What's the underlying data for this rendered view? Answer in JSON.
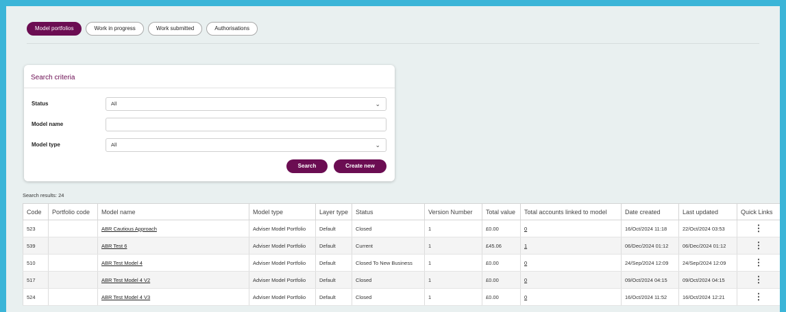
{
  "tabs": [
    {
      "label": "Model portfolios",
      "active": true
    },
    {
      "label": "Work in progress",
      "active": false
    },
    {
      "label": "Work submitted",
      "active": false
    },
    {
      "label": "Authorisations",
      "active": false
    }
  ],
  "search": {
    "title": "Search criteria",
    "status_label": "Status",
    "status_value": "All",
    "model_name_label": "Model name",
    "model_name_value": "",
    "model_type_label": "Model type",
    "model_type_value": "All",
    "search_button": "Search",
    "create_button": "Create new"
  },
  "results": {
    "summary": "Search results: 24",
    "columns": [
      "Code",
      "Portfolio code",
      "Model name",
      "Model type",
      "Layer type",
      "Status",
      "Version Number",
      "Total value",
      "Total accounts linked to model",
      "Date created",
      "Last updated",
      "Quick Links"
    ],
    "rows": [
      {
        "code": "523",
        "portfolio_code": "",
        "model_name": "ABR Cautious Approach",
        "model_type": "Adviser Model Portfolio",
        "layer_type": "Default",
        "status": "Closed",
        "version": "1",
        "total_value": "£0.00",
        "accounts": "0",
        "created": "16/Oct/2024 11:18",
        "updated": "22/Oct/2024 03:53"
      },
      {
        "code": "539",
        "portfolio_code": "",
        "model_name": "ABR Test 6",
        "model_type": "Adviser Model Portfolio",
        "layer_type": "Default",
        "status": "Current",
        "version": "1",
        "total_value": "£45.06",
        "accounts": "1",
        "created": "06/Dec/2024 01:12",
        "updated": "06/Dec/2024 01:12"
      },
      {
        "code": "510",
        "portfolio_code": "",
        "model_name": "ABR Test Model 4",
        "model_type": "Adviser Model Portfolio",
        "layer_type": "Default",
        "status": "Closed To New Business",
        "version": "1",
        "total_value": "£0.00",
        "accounts": "0",
        "created": "24/Sep/2024 12:09",
        "updated": "24/Sep/2024 12:09"
      },
      {
        "code": "517",
        "portfolio_code": "",
        "model_name": "ABR Test Model 4 V2",
        "model_type": "Adviser Model Portfolio",
        "layer_type": "Default",
        "status": "Closed",
        "version": "1",
        "total_value": "£0.00",
        "accounts": "0",
        "created": "09/Oct/2024 04:15",
        "updated": "09/Oct/2024 04:15"
      },
      {
        "code": "524",
        "portfolio_code": "",
        "model_name": "ABR Test Model 4 V3",
        "model_type": "Adviser Model Portfolio",
        "layer_type": "Default",
        "status": "Closed",
        "version": "1",
        "total_value": "£0.00",
        "accounts": "0",
        "created": "16/Oct/2024 11:52",
        "updated": "16/Oct/2024 12:21"
      }
    ]
  },
  "icons": {
    "chevron": "⌄",
    "kebab": "⋮"
  },
  "colors": {
    "brand": "#6b0d52",
    "frame": "#3bb5d8",
    "page_bg": "#e9f0f0"
  }
}
